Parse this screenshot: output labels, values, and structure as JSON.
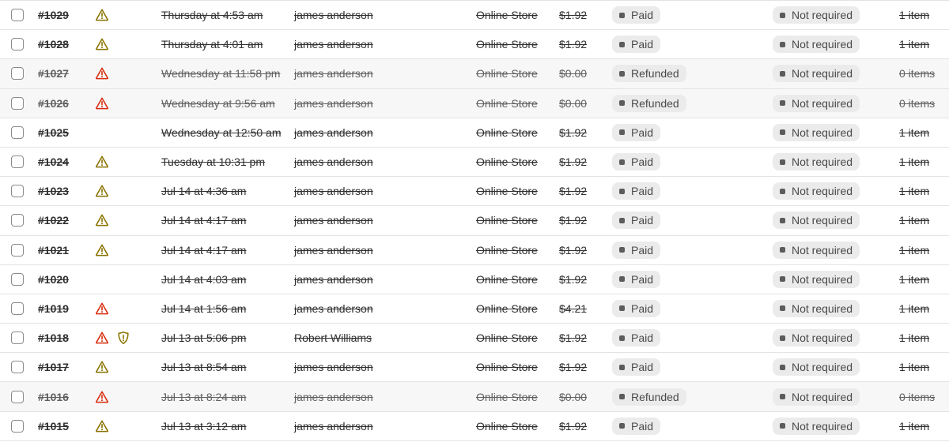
{
  "colors": {
    "warning_yellow": "#8a7300",
    "critical_red": "#d82c0d",
    "badge_bg": "#ebebeb",
    "row_muted_bg": "#f7f7f7"
  },
  "orders": [
    {
      "order": "#1029",
      "icons": [
        "warning-yellow-icon"
      ],
      "date": "Thursday at 4:53 am",
      "customer": "james anderson",
      "channel": "Online Store",
      "total": "$1.92",
      "payment": "Paid",
      "fulfillment": "Not required",
      "items": "1 item",
      "muted": false
    },
    {
      "order": "#1028",
      "icons": [
        "warning-yellow-icon"
      ],
      "date": "Thursday at 4:01 am",
      "customer": "james anderson",
      "channel": "Online Store",
      "total": "$1.92",
      "payment": "Paid",
      "fulfillment": "Not required",
      "items": "1 item",
      "muted": false
    },
    {
      "order": "#1027",
      "icons": [
        "warning-red-icon"
      ],
      "date": "Wednesday at 11:58 pm",
      "customer": "james anderson",
      "channel": "Online Store",
      "total": "$0.00",
      "payment": "Refunded",
      "fulfillment": "Not required",
      "items": "0 items",
      "muted": true
    },
    {
      "order": "#1026",
      "icons": [
        "warning-red-icon"
      ],
      "date": "Wednesday at 9:56 am",
      "customer": "james anderson",
      "channel": "Online Store",
      "total": "$0.00",
      "payment": "Refunded",
      "fulfillment": "Not required",
      "items": "0 items",
      "muted": true
    },
    {
      "order": "#1025",
      "icons": [],
      "date": "Wednesday at 12:50 am",
      "customer": "james anderson",
      "channel": "Online Store",
      "total": "$1.92",
      "payment": "Paid",
      "fulfillment": "Not required",
      "items": "1 item",
      "muted": false
    },
    {
      "order": "#1024",
      "icons": [
        "warning-yellow-icon"
      ],
      "date": "Tuesday at 10:31 pm",
      "customer": "james anderson",
      "channel": "Online Store",
      "total": "$1.92",
      "payment": "Paid",
      "fulfillment": "Not required",
      "items": "1 item",
      "muted": false
    },
    {
      "order": "#1023",
      "icons": [
        "warning-yellow-icon"
      ],
      "date": "Jul 14 at 4:36 am",
      "customer": "james anderson",
      "channel": "Online Store",
      "total": "$1.92",
      "payment": "Paid",
      "fulfillment": "Not required",
      "items": "1 item",
      "muted": false
    },
    {
      "order": "#1022",
      "icons": [
        "warning-yellow-icon"
      ],
      "date": "Jul 14 at 4:17 am",
      "customer": "james anderson",
      "channel": "Online Store",
      "total": "$1.92",
      "payment": "Paid",
      "fulfillment": "Not required",
      "items": "1 item",
      "muted": false
    },
    {
      "order": "#1021",
      "icons": [
        "warning-yellow-icon"
      ],
      "date": "Jul 14 at 4:17 am",
      "customer": "james anderson",
      "channel": "Online Store",
      "total": "$1.92",
      "payment": "Paid",
      "fulfillment": "Not required",
      "items": "1 item",
      "muted": false
    },
    {
      "order": "#1020",
      "icons": [],
      "date": "Jul 14 at 4:03 am",
      "customer": "james anderson",
      "channel": "Online Store",
      "total": "$1.92",
      "payment": "Paid",
      "fulfillment": "Not required",
      "items": "1 item",
      "muted": false
    },
    {
      "order": "#1019",
      "icons": [
        "warning-red-icon"
      ],
      "date": "Jul 14 at 1:56 am",
      "customer": "james anderson",
      "channel": "Online Store",
      "total": "$4.21",
      "payment": "Paid",
      "fulfillment": "Not required",
      "items": "1 item",
      "muted": false
    },
    {
      "order": "#1018",
      "icons": [
        "warning-red-icon",
        "alert-yellow-icon"
      ],
      "date": "Jul 13 at 5:06 pm",
      "customer": "Robert Williams",
      "channel": "Online Store",
      "total": "$1.92",
      "payment": "Paid",
      "fulfillment": "Not required",
      "items": "1 item",
      "muted": false
    },
    {
      "order": "#1017",
      "icons": [
        "warning-yellow-icon"
      ],
      "date": "Jul 13 at 8:54 am",
      "customer": "james anderson",
      "channel": "Online Store",
      "total": "$1.92",
      "payment": "Paid",
      "fulfillment": "Not required",
      "items": "1 item",
      "muted": false
    },
    {
      "order": "#1016",
      "icons": [
        "warning-red-icon"
      ],
      "date": "Jul 13 at 8:24 am",
      "customer": "james anderson",
      "channel": "Online Store",
      "total": "$0.00",
      "payment": "Refunded",
      "fulfillment": "Not required",
      "items": "0 items",
      "muted": true
    },
    {
      "order": "#1015",
      "icons": [
        "warning-yellow-icon"
      ],
      "date": "Jul 13 at 3:12 am",
      "customer": "james anderson",
      "channel": "Online Store",
      "total": "$1.92",
      "payment": "Paid",
      "fulfillment": "Not required",
      "items": "1 item",
      "muted": false
    }
  ]
}
